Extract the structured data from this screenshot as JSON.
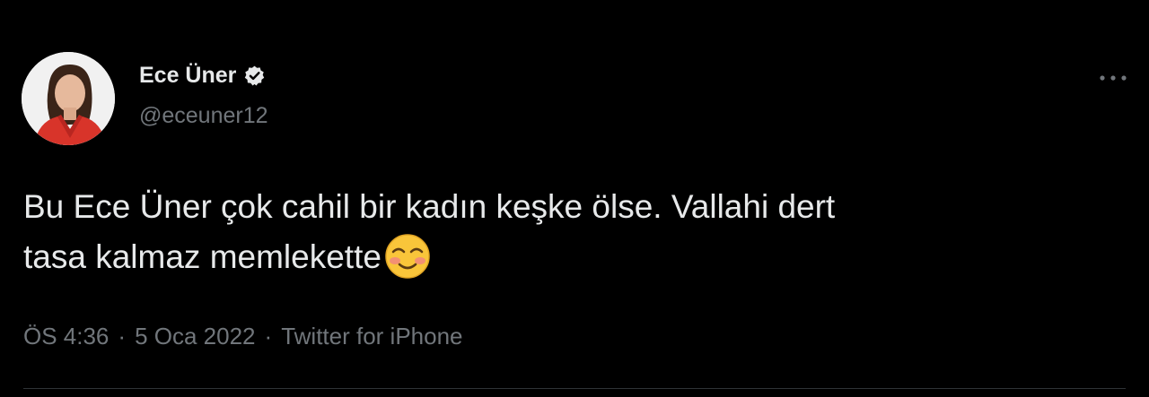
{
  "author": {
    "display_name": "Ece Üner",
    "handle": "@eceuner12",
    "verified": true
  },
  "tweet": {
    "text_line1": "Bu Ece Üner çok cahil bir kadın keşke ölse. Vallahi dert",
    "text_line2": "tasa kalmaz memlekette",
    "emoji": "smiling-face-with-blush-icon"
  },
  "meta": {
    "time": "ÖS 4:36",
    "separator": "·",
    "date": "5 Oca 2022",
    "source": "Twitter for iPhone"
  },
  "colors": {
    "background": "#000000",
    "primary_text": "#e7e9ea",
    "secondary_text": "#71767b",
    "divider": "#2f3336"
  }
}
